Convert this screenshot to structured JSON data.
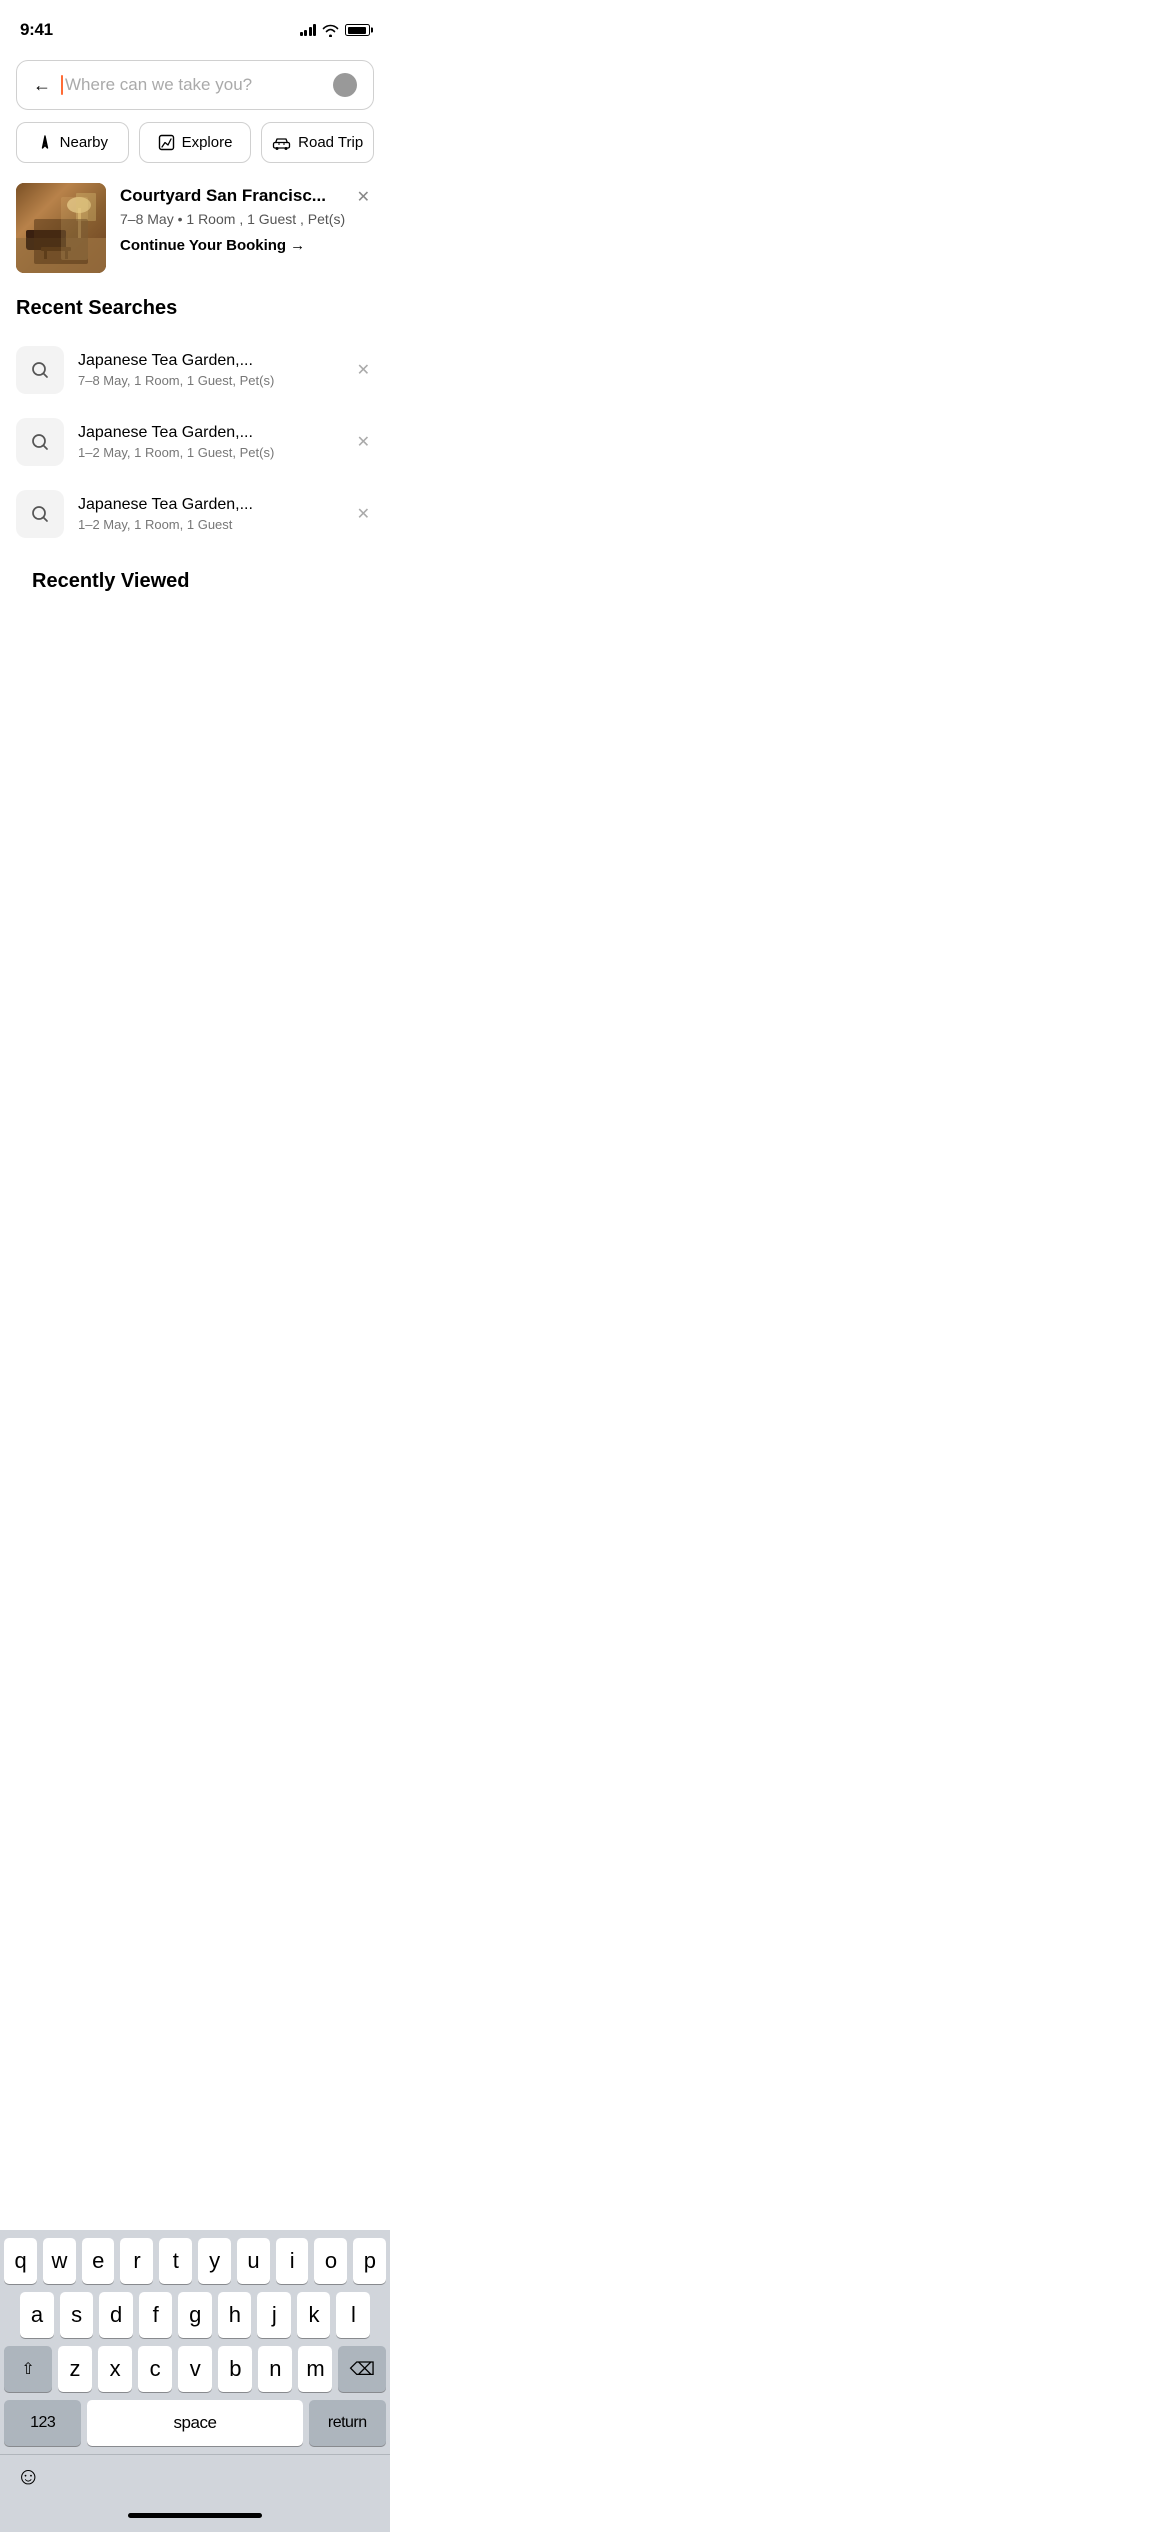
{
  "statusBar": {
    "time": "9:41",
    "signalBars": [
      3,
      6,
      9,
      11
    ],
    "battery": 90
  },
  "searchBar": {
    "placeholder": "Where can we take you?",
    "backLabel": "←"
  },
  "quickActions": [
    {
      "id": "nearby",
      "label": "Nearby",
      "icon": "◁"
    },
    {
      "id": "explore",
      "label": "Explore",
      "icon": "⊞"
    },
    {
      "id": "road-trip",
      "label": "Road Trip",
      "icon": "⊟"
    }
  ],
  "continueBooking": {
    "hotelName": "Courtyard San Francisc...",
    "dates": "7–8 May",
    "rooms": "1 Room",
    "guests": "1 Guest",
    "extras": "Pet(s)",
    "ctaLabel": "Continue Your Booking",
    "ctaArrow": "→"
  },
  "recentSearches": {
    "sectionLabel": "Recent Searches",
    "items": [
      {
        "name": "Japanese Tea Garden,...",
        "details": "7–8 May, 1 Room, 1 Guest, Pet(s)"
      },
      {
        "name": "Japanese Tea Garden,...",
        "details": "1–2 May, 1 Room, 1 Guest, Pet(s)"
      },
      {
        "name": "Japanese Tea Garden,...",
        "details": "1–2 May, 1 Room, 1 Guest"
      }
    ]
  },
  "recentlyViewed": {
    "sectionLabel": "Recently Viewed"
  },
  "keyboard": {
    "rows": [
      [
        "q",
        "w",
        "e",
        "r",
        "t",
        "y",
        "u",
        "i",
        "o",
        "p"
      ],
      [
        "a",
        "s",
        "d",
        "f",
        "g",
        "h",
        "j",
        "k",
        "l"
      ],
      [
        "z",
        "x",
        "c",
        "v",
        "b",
        "n",
        "m"
      ]
    ],
    "specialKeys": {
      "shift": "⇧",
      "delete": "⌫",
      "numbers": "123",
      "space": "space",
      "return": "return"
    },
    "emojiIcon": "☺"
  }
}
